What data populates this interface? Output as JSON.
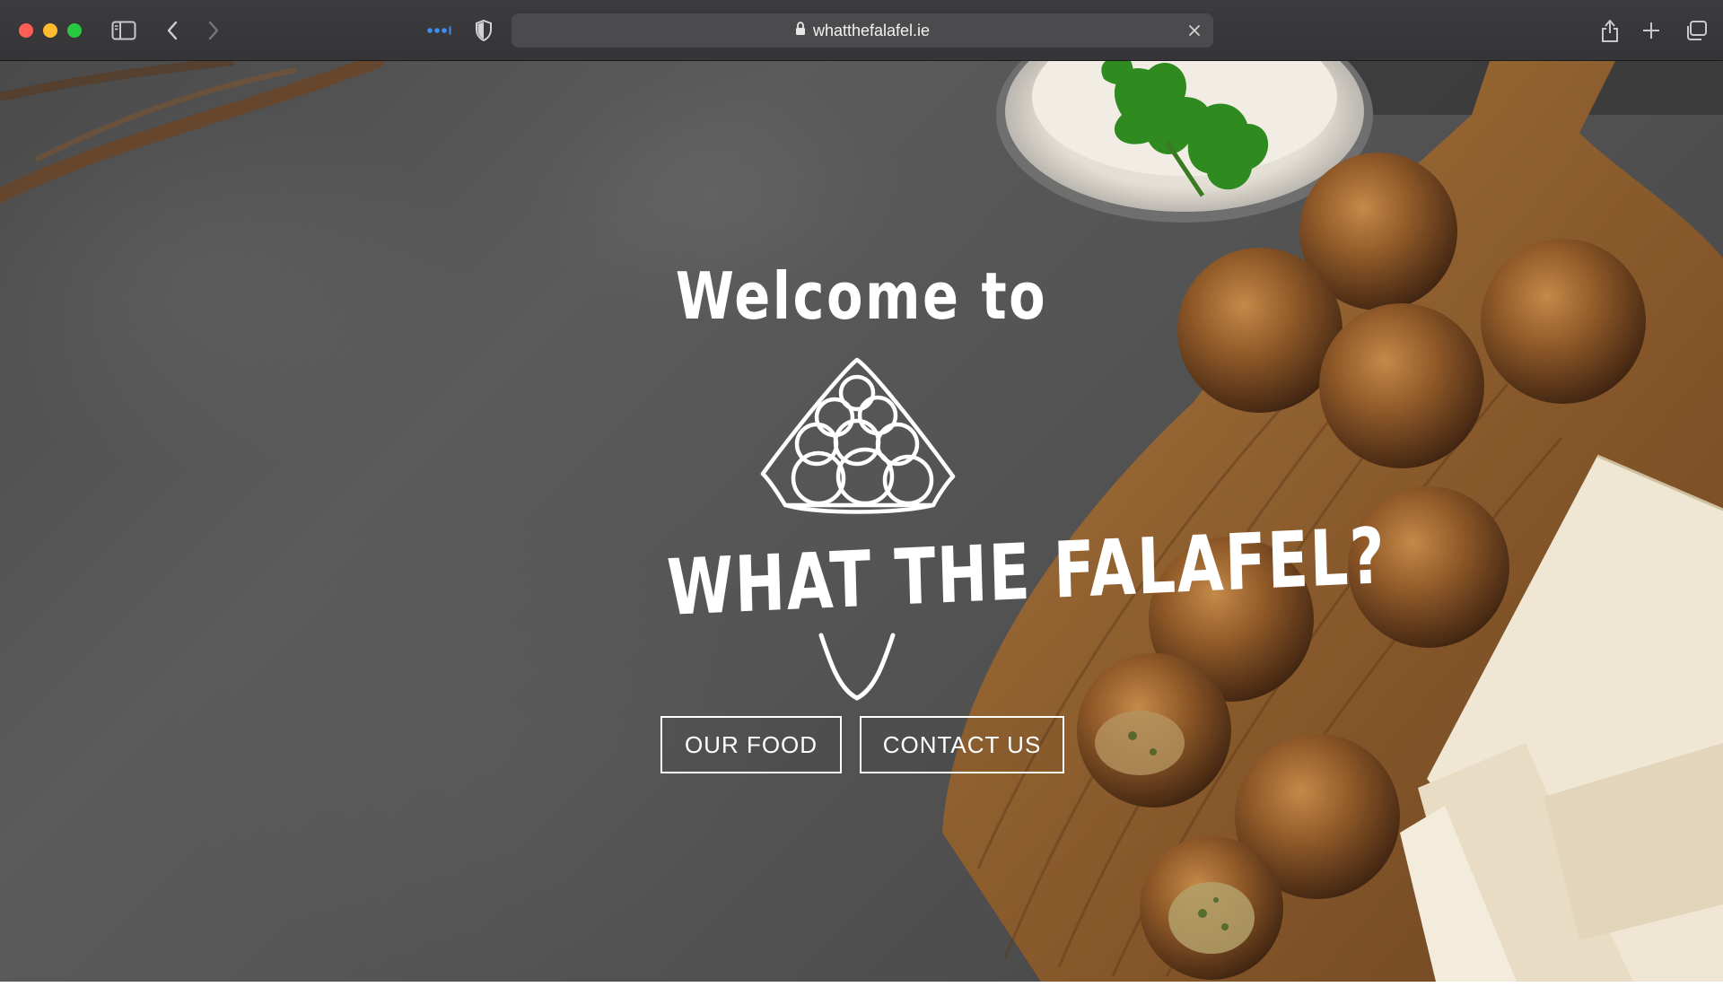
{
  "browser": {
    "url": "whatthefalafel.ie",
    "icons": {
      "sidebar": "sidebar-icon",
      "back": "chevron-left-icon",
      "forward": "chevron-right-icon",
      "extensions": "ellipsis-icon",
      "privacy": "shield-icon",
      "lock": "lock-icon",
      "clear": "close-icon",
      "share": "share-icon",
      "new_tab": "plus-icon",
      "tabs": "tabs-overview-icon"
    }
  },
  "hero": {
    "welcome": "Welcome to",
    "brand": "WHAT THE FALAFEL?",
    "buttons": {
      "our_food": "OUR FOOD",
      "contact": "CONTACT US"
    }
  },
  "colors": {
    "toolbar": "#3a393b",
    "address_bar": "#4b4a4d",
    "slate": "#525252",
    "wood": "#8a5a2e",
    "falafel": "#8b5a2b",
    "pita": "#efe6d3",
    "button_border": "#ffffff"
  }
}
